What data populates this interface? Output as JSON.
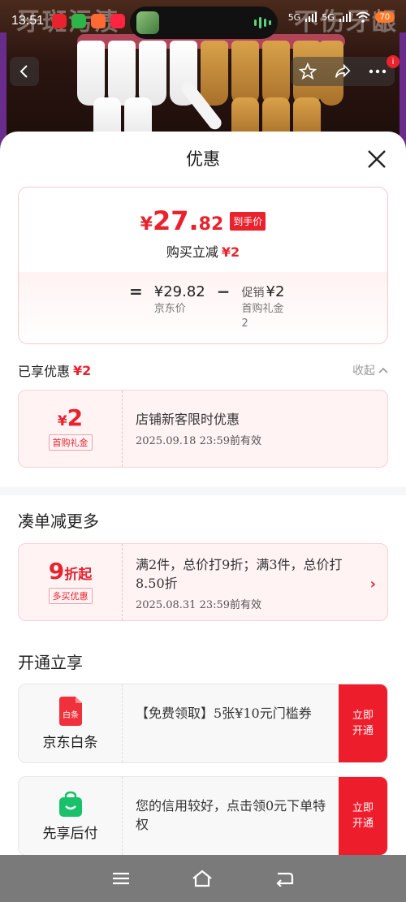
{
  "status": {
    "time": "13:51",
    "battery": "70",
    "bg_text_left": "牙斑污渍",
    "bg_text_right": "不伤牙龈",
    "net1": "5G",
    "net2": "5G"
  },
  "sheet": {
    "title": "优惠",
    "price": {
      "yen": "¥",
      "int": "27.",
      "dec": "82",
      "tag": "到手价"
    },
    "reduce": {
      "label": "购买立减",
      "amount": "¥2"
    },
    "calc": {
      "eq": "=",
      "base_value": "¥29.82",
      "base_label": "京东价",
      "minus": "−",
      "promo_prefix": "促销",
      "promo_value": "¥2",
      "promo_label": "首购礼金",
      "promo_count": "2"
    },
    "enjoyed": {
      "label": "已享优惠",
      "amount": "¥2",
      "collapse": "收起"
    },
    "coupon1": {
      "yen": "¥",
      "value": "2",
      "tag": "首购礼金",
      "title": "店铺新客限时优惠",
      "expire": "2025.09.18 23:59前有效"
    },
    "more_title": "凑单减更多",
    "coupon2": {
      "value": "9",
      "unit": "折起",
      "tag": "多买优惠",
      "title": "满2件，总价打9折；满3件，总价打8.50折",
      "expire": "2025.08.31 23:59前有效"
    },
    "open_title": "开通立享",
    "baitiao": {
      "name": "京东白条",
      "icon_text": "白条",
      "desc": "【免费领取】5张¥10元门槛券",
      "btn": "立即开通"
    },
    "xianxiang": {
      "name": "先享后付",
      "desc": "您的信用较好，点击领0元下单特权",
      "btn": "立即开通"
    }
  },
  "colors": {
    "accent": "#e8232e",
    "button": "#ee1d2b",
    "navbar": "#7a7a7a"
  },
  "icons": [
    "back-icon",
    "star-icon",
    "share-icon",
    "more-icon",
    "close-icon",
    "chevron-up-icon",
    "chevron-right-icon",
    "menu-icon",
    "home-icon",
    "back-nav-icon"
  ]
}
